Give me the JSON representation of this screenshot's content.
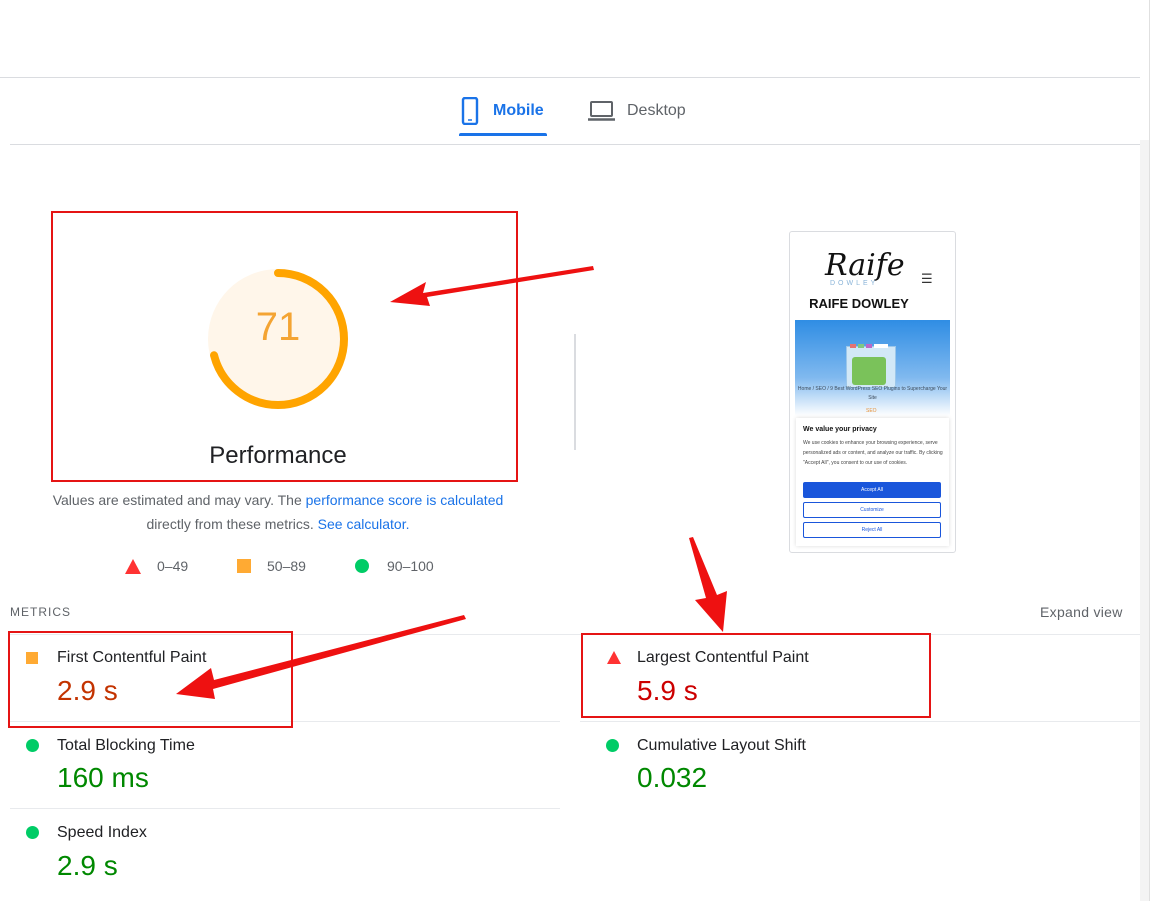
{
  "tabs": [
    {
      "label": "Mobile",
      "active": true
    },
    {
      "label": "Desktop",
      "active": false
    }
  ],
  "score": {
    "value": 71,
    "max": 100,
    "label": "Performance",
    "color": "#ffa400"
  },
  "estimate": {
    "text1": "Values are estimated and may vary. The ",
    "link1": "performance score is calculated",
    "text2": "directly from these metrics. ",
    "link2": "See calculator."
  },
  "legend": {
    "poor": "0–49",
    "average": "50–89",
    "good": "90–100"
  },
  "thumbnail": {
    "logo_script": "Raife",
    "logo_sub": "DOWLEY",
    "site_name": "RAIFE DOWLEY",
    "hero_caption": "Home / SEO / 9 Best WordPress SEO Plugins to Supercharge Your Site",
    "hero_tag": "SEO",
    "privacy_title": "We value your privacy",
    "privacy_body": "We use cookies to enhance your browsing experience, serve personalized ads or content, and analyze our traffic. By clicking \"Accept All\", you consent to our use of cookies.",
    "accept": "Accept All",
    "customize": "Customize",
    "reject": "Reject All"
  },
  "metrics": {
    "heading": "METRICS",
    "expand": "Expand view",
    "fcp": {
      "label": "First Contentful Paint",
      "value": "2.9 s",
      "rating": "average"
    },
    "lcp": {
      "label": "Largest Contentful Paint",
      "value": "5.9 s",
      "rating": "poor"
    },
    "tbt": {
      "label": "Total Blocking Time",
      "value": "160 ms",
      "rating": "good"
    },
    "cls": {
      "label": "Cumulative Layout Shift",
      "value": "0.032",
      "rating": "good"
    },
    "si": {
      "label": "Speed Index",
      "value": "2.9 s",
      "rating": "good"
    }
  },
  "colors": {
    "accent": "#1a73e8",
    "poor": "#ff3333",
    "average": "#ffaa33",
    "good": "#00cc66",
    "annotation": "#e51414"
  }
}
